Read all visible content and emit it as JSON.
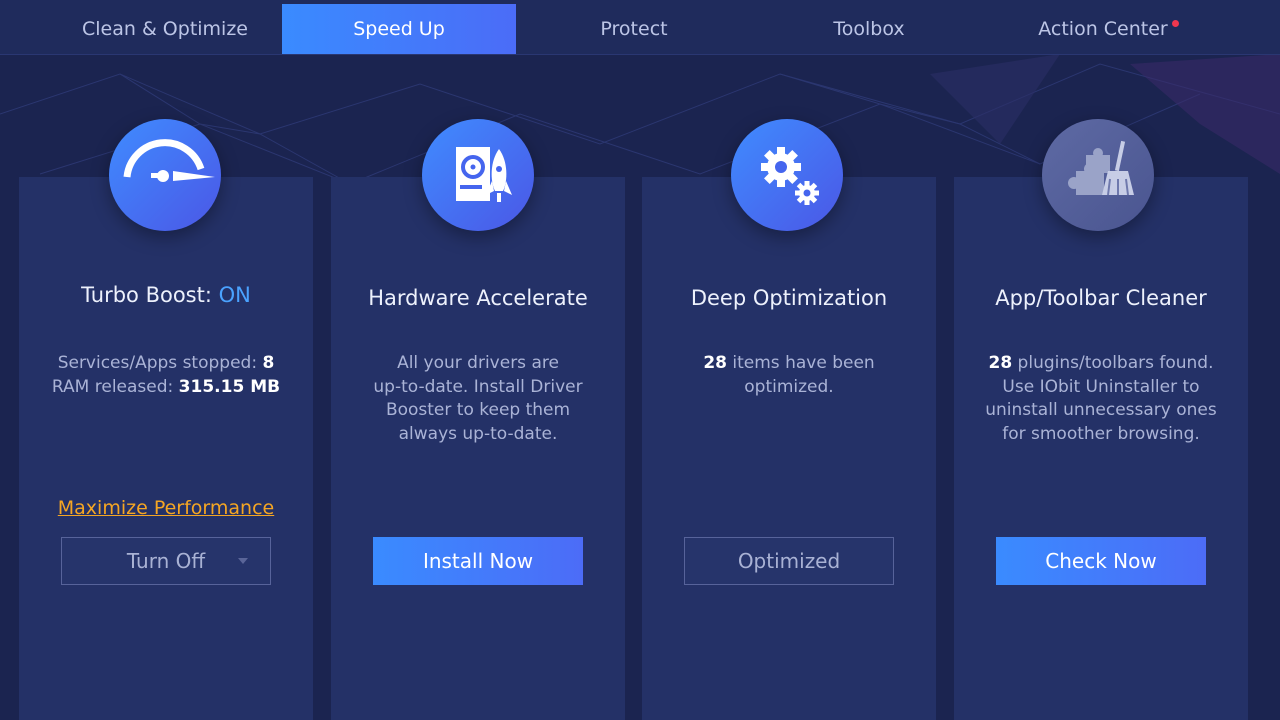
{
  "tabs": [
    {
      "label": "Clean & Optimize"
    },
    {
      "label": "Speed Up"
    },
    {
      "label": "Protect"
    },
    {
      "label": "Toolbox"
    },
    {
      "label": "Action Center"
    }
  ],
  "active_tab": "Speed Up",
  "colors": {
    "accent": "#3a8bff",
    "on_text": "#4aa2ff",
    "link": "#f5a623",
    "notification_dot": "#f0374f"
  },
  "cards": [
    {
      "icon": "speedometer-icon",
      "title": "Turbo Boost: ",
      "title_status": "ON",
      "line1_label": "Services/Apps stopped: ",
      "line1_value": "8",
      "line2_label": "RAM released: ",
      "line2_value": "315.15 MB",
      "link": "Maximize Performance",
      "button": "Turn Off"
    },
    {
      "icon": "hardware-rocket-icon",
      "title": "Hardware Accelerate",
      "desc_lines": [
        "All your drivers are",
        "up-to-date. Install Driver",
        "Booster to keep them",
        "always up-to-date."
      ],
      "button": "Install Now"
    },
    {
      "icon": "gears-icon",
      "title": "Deep Optimization",
      "count": "28",
      "desc_line1": " items have been",
      "desc_line2": "optimized.",
      "button": "Optimized"
    },
    {
      "icon": "puzzle-broom-icon",
      "title": "App/Toolbar Cleaner",
      "count": "28",
      "desc_line1": " plugins/toolbars found.",
      "desc_lines": [
        "Use IObit Uninstaller to",
        "uninstall unnecessary ones",
        "for smoother browsing."
      ],
      "button": "Check Now"
    }
  ]
}
